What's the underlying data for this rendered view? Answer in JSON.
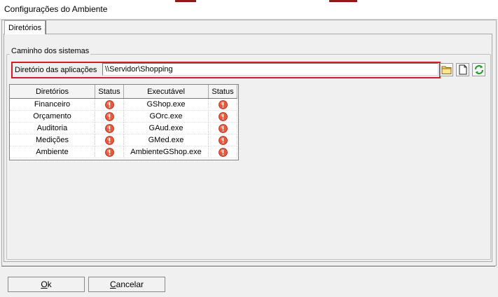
{
  "window": {
    "title": "Configurações do Ambiente",
    "accent_color": "#8e1a1a"
  },
  "tabs": [
    {
      "label": "Diretórios",
      "active": true
    }
  ],
  "group": {
    "title": "Caminho dos sistemas",
    "directory_label": "Diretório das aplicações",
    "directory_value": "\\\\Servidor\\Shopping",
    "highlight_color": "#d61c2a",
    "buttons": [
      {
        "icon": "folder-icon"
      },
      {
        "icon": "new-document-icon"
      },
      {
        "icon": "refresh-icon"
      }
    ]
  },
  "table": {
    "headers": [
      "Diretórios",
      "Status",
      "Executável",
      "Status"
    ],
    "rows": [
      {
        "directory": "Financeiro",
        "dir_status": "warning-icon",
        "executable": "GShop.exe",
        "exe_status": "warning-icon"
      },
      {
        "directory": "Orçamento",
        "dir_status": "warning-icon",
        "executable": "GOrc.exe",
        "exe_status": "warning-icon"
      },
      {
        "directory": "Auditoria",
        "dir_status": "warning-icon",
        "executable": "GAud.exe",
        "exe_status": "warning-icon"
      },
      {
        "directory": "Medições",
        "dir_status": "warning-icon",
        "executable": "GMed.exe",
        "exe_status": "warning-icon"
      },
      {
        "directory": "Ambiente",
        "dir_status": "warning-icon",
        "executable": "AmbienteGShop.exe",
        "exe_status": "warning-icon"
      }
    ]
  },
  "footer": {
    "ok": {
      "mnemonic": "O",
      "rest": "k"
    },
    "cancel": {
      "mnemonic": "C",
      "rest": "ancelar"
    }
  }
}
